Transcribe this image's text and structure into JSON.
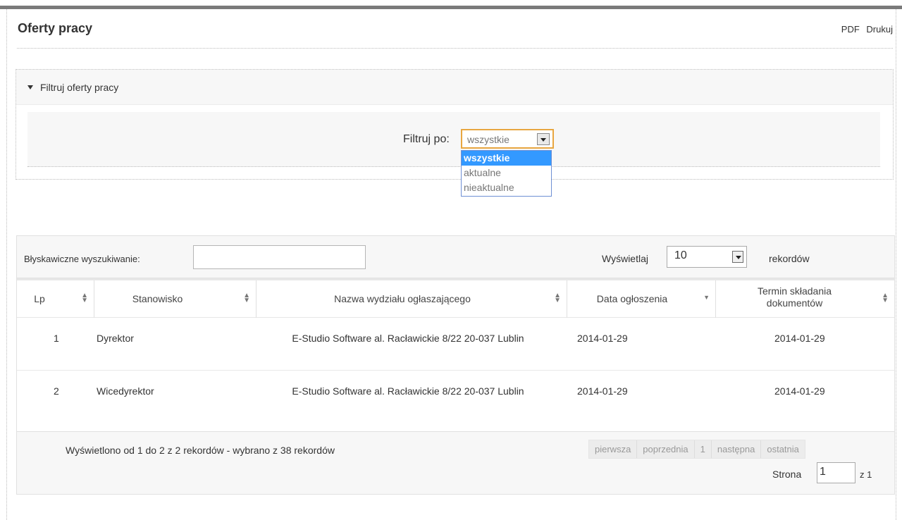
{
  "header": {
    "title": "Oferty pracy",
    "pdf_link": "PDF",
    "print_link": "Drukuj"
  },
  "filter": {
    "toggle_label": "Filtruj oferty pracy",
    "filter_label": "Filtruj po:",
    "selected_value": "wszystkie",
    "options": [
      "wszystkie",
      "aktualne",
      "nieaktualne"
    ]
  },
  "table_toolbar": {
    "search_label": "Błyskawiczne wyszukiwanie:",
    "search_value": "",
    "length_label": "Wyświetlaj",
    "length_value": "10",
    "records_label": "rekordów"
  },
  "columns": [
    "Lp",
    "Stanowisko",
    "Nazwa wydziału ogłaszającego",
    "Data ogłoszenia",
    "Termin składania dokumentów"
  ],
  "rows": [
    {
      "lp": "1",
      "position": "Dyrektor",
      "department": "E-Studio Software al. Racławickie 8/22 20-037 Lublin",
      "announcement_date": "2014-01-29",
      "deadline": "2014-01-29"
    },
    {
      "lp": "2",
      "position": "Wicedyrektor",
      "department": "E-Studio Software al. Racławickie 8/22 20-037 Lublin",
      "announcement_date": "2014-01-29",
      "deadline": "2014-01-29"
    }
  ],
  "footer": {
    "info": "Wyświetlono od 1 do 2 z 2 rekordów - wybrano z 38 rekordów",
    "pager": {
      "first": "pierwsza",
      "previous": "poprzednia",
      "page": "1",
      "next": "następna",
      "last": "ostatnia"
    },
    "page_label": "Strona",
    "page_value": "1",
    "page_of": "z 1"
  },
  "icons": {
    "filter_toggle": "triangle-down-icon",
    "sort": "sort-arrows-icon",
    "sort_active": "sort-descending-icon"
  }
}
